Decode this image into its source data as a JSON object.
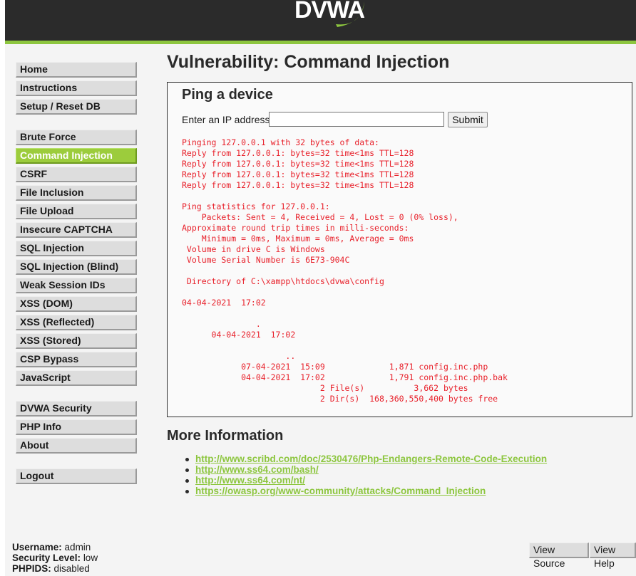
{
  "header": {
    "logo_text": "DVWA",
    "colors": {
      "background": "#2b2b2b",
      "accent": "#8dc63f"
    }
  },
  "menu": {
    "items": [
      {
        "label": "Home",
        "selected": false
      },
      {
        "label": "Instructions",
        "selected": false
      },
      {
        "label": "Setup / Reset DB",
        "selected": false
      },
      {
        "label": "Brute Force",
        "selected": false
      },
      {
        "label": "Command Injection",
        "selected": true
      },
      {
        "label": "CSRF",
        "selected": false
      },
      {
        "label": "File Inclusion",
        "selected": false
      },
      {
        "label": "File Upload",
        "selected": false
      },
      {
        "label": "Insecure CAPTCHA",
        "selected": false
      },
      {
        "label": "SQL Injection",
        "selected": false
      },
      {
        "label": "SQL Injection (Blind)",
        "selected": false
      },
      {
        "label": "Weak Session IDs",
        "selected": false
      },
      {
        "label": "XSS (DOM)",
        "selected": false
      },
      {
        "label": "XSS (Reflected)",
        "selected": false
      },
      {
        "label": "XSS (Stored)",
        "selected": false
      },
      {
        "label": "CSP Bypass",
        "selected": false
      },
      {
        "label": "JavaScript",
        "selected": false
      },
      {
        "label": "DVWA Security",
        "selected": false
      },
      {
        "label": "PHP Info",
        "selected": false
      },
      {
        "label": "About",
        "selected": false
      },
      {
        "label": "Logout",
        "selected": false
      }
    ]
  },
  "main": {
    "title": "Vulnerability: Command Injection",
    "section_heading": "Ping a device",
    "ip_label": "Enter an IP address:",
    "ip_value": "",
    "submit_label": "Submit",
    "output": "Pinging 127.0.0.1 with 32 bytes of data:\nReply from 127.0.0.1: bytes=32 time<1ms TTL=128\nReply from 127.0.0.1: bytes=32 time<1ms TTL=128\nReply from 127.0.0.1: bytes=32 time<1ms TTL=128\nReply from 127.0.0.1: bytes=32 time<1ms TTL=128\n\nPing statistics for 127.0.0.1:\n    Packets: Sent = 4, Received = 4, Lost = 0 (0% loss),\nApproximate round trip times in milli-seconds:\n    Minimum = 0ms, Maximum = 0ms, Average = 0ms\n Volume in drive C is Windows\n Volume Serial Number is 6E73-904C\n\n Directory of C:\\xampp\\htdocs\\dvwa\\config\n\n04-04-2021  17:02\n\n               .\n      04-04-2021  17:02\n\n                     ..\n            07-04-2021  15:09             1,871 config.inc.php\n            04-04-2021  17:02             1,791 config.inc.php.bak\n                            2 File(s)          3,662 bytes\n                            2 Dir(s)  168,360,550,400 bytes free",
    "output_color": "#e8202a"
  },
  "more_info": {
    "heading": "More Information",
    "links": [
      "http://www.scribd.com/doc/2530476/Php-Endangers-Remote-Code-Execution",
      "http://www.ss64.com/bash/",
      "http://www.ss64.com/nt/",
      "https://owasp.org/www-community/attacks/Command_Injection"
    ]
  },
  "footer": {
    "username_label": "Username:",
    "username_value": "admin",
    "security_label": "Security Level:",
    "security_value": "low",
    "phpids_label": "PHPIDS:",
    "phpids_value": "disabled",
    "view_source_label": "View Source",
    "view_help_label": "View Help"
  }
}
